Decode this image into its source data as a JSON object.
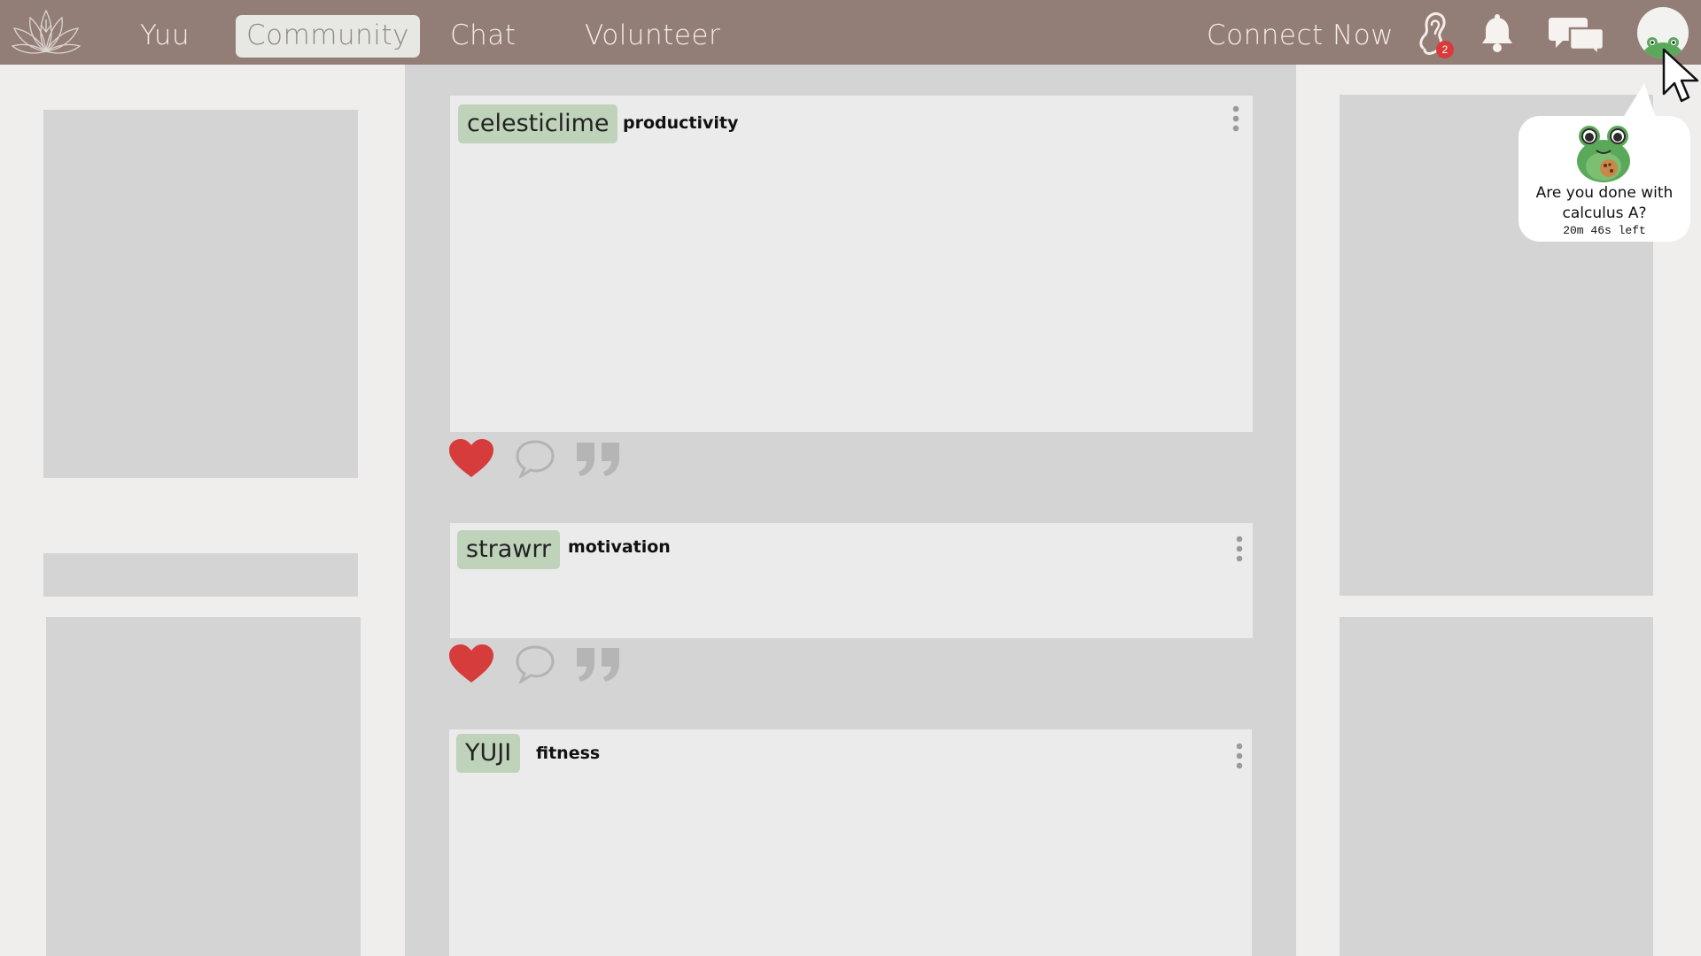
{
  "nav": {
    "items": [
      {
        "label": "Yuu"
      },
      {
        "label": "Community",
        "active": true
      },
      {
        "label": "Chat"
      },
      {
        "label": "Volunteer"
      }
    ],
    "connect_label": "Connect Now",
    "ear_badge": "2",
    "icons": [
      "lotus-logo-icon",
      "ear-icon",
      "bell-icon",
      "chat-bubbles-icon",
      "frog-avatar-icon"
    ]
  },
  "posts": [
    {
      "user": "celesticlime",
      "tag": "productivity"
    },
    {
      "user": "strawrr",
      "tag": "motivation"
    },
    {
      "user": "YUJI",
      "tag": "fitness"
    }
  ],
  "reminder": {
    "message": "Are you done with calculus A?",
    "timer": "20m 46s left"
  },
  "colors": {
    "nav_bg": "#937e77",
    "page_bg": "#efeeed",
    "panel": "#d4d4d4",
    "card": "#ebebeb",
    "user_chip": "#bfd3bb",
    "heart": "#d63c3c",
    "badge": "#d93b3b",
    "frog": "#5aa859"
  }
}
